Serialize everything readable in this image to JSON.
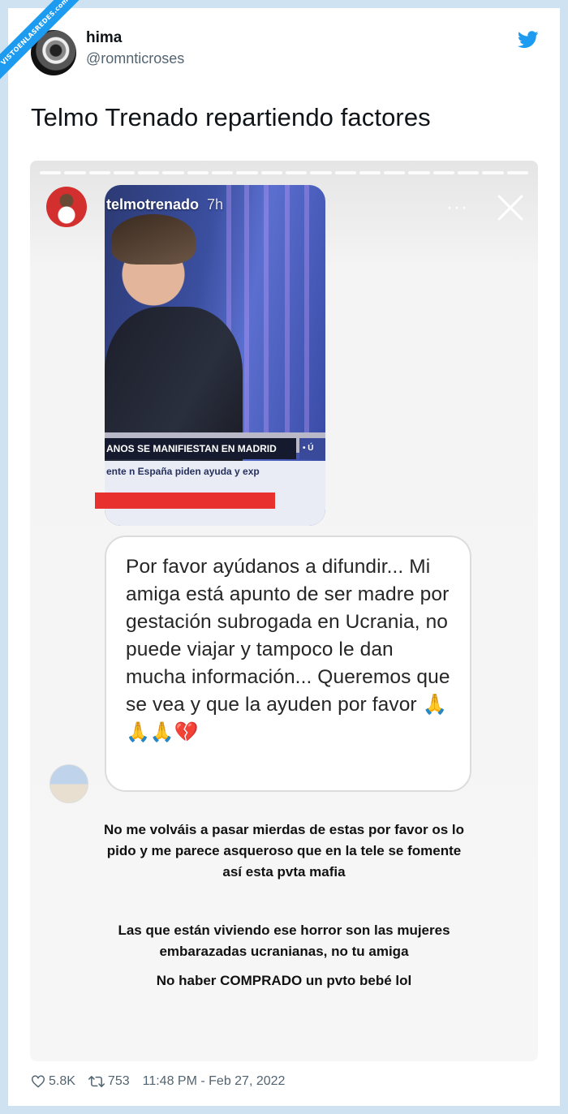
{
  "watermark": "VISTOENLASREDES.com",
  "tweet": {
    "user_name": "hima",
    "user_handle": "@romnticroses",
    "text": "Telmo Trenado repartiendo factores",
    "likes": "5.8K",
    "retweets": "753",
    "timestamp": "11:48 PM - Feb 27, 2022"
  },
  "story": {
    "username": "telmotrenado",
    "time": "7h",
    "more_label": "···",
    "video": {
      "lower_third": "ANOS SE MANIFIESTAN EN MADRID",
      "lower_third_tag": "• Ú",
      "ticker": "ente   n España piden ayuda y exp"
    },
    "message": "Por favor ayúdanos a difundir... Mi amiga está apunto de ser madre por gestación subrogada en Ucrania, no puede viajar y tampoco le dan mucha información... Queremos que se vea y que la ayuden por favor",
    "message_emoji_end": "🙏",
    "message_emoji_row": "🙏🙏",
    "message_heart": "💔",
    "caption_1": "No me volváis a pasar  mierdas de estas por favor os lo pido y me parece asqueroso que en la tele se fomente así esta pvta mafia",
    "caption_2": "Las que están viviendo ese horror son las mujeres embarazadas ucranianas, no tu amiga",
    "caption_3": "No haber COMPRADO un pvto bebé lol"
  },
  "colors": {
    "brand": "#1d9bf0",
    "page_bg": "#cfe2f1",
    "red_bar": "#e8302f"
  },
  "icons": [
    "twitter-bird-icon",
    "close-icon",
    "heart-icon",
    "retweet-icon"
  ]
}
